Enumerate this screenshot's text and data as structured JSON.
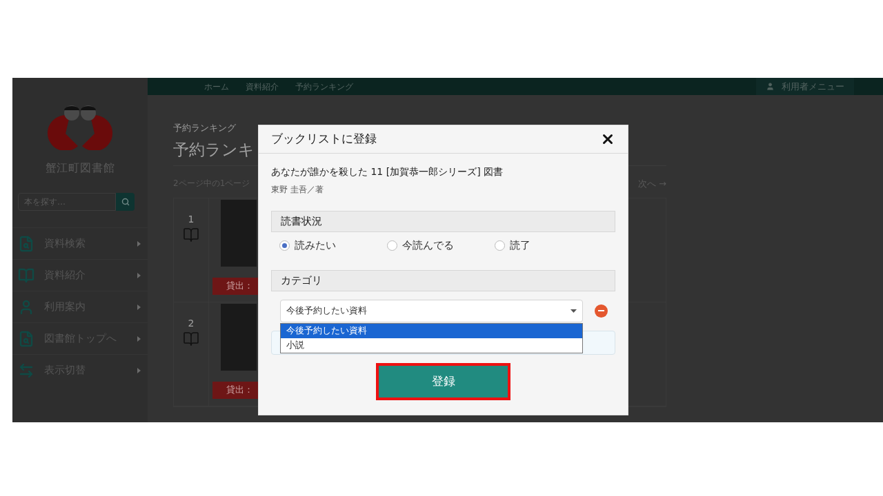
{
  "top_nav": {
    "breadcrumbs": [
      "ホーム",
      "資料紹介",
      "予約ランキング"
    ],
    "user_menu": "利用者メニュー"
  },
  "sidebar": {
    "library_name": "蟹江町図書館",
    "search": {
      "placeholder": "本を探す…"
    },
    "items": [
      {
        "kind": "search",
        "label": "資料検索"
      },
      {
        "kind": "book",
        "label": "資料紹介"
      },
      {
        "kind": "person",
        "label": "利用案内"
      },
      {
        "kind": "search",
        "label": "図書館トップへ"
      },
      {
        "kind": "switch",
        "label": "表示切替"
      }
    ]
  },
  "main": {
    "breadcrumb": "予約ランキング",
    "heading": "予約ランキ",
    "page_info": "2ページ中の1ページ",
    "next": "次へ →",
    "rows": [
      {
        "rank": "1",
        "status": "貸出："
      },
      {
        "rank": "2",
        "status": "貸出："
      }
    ]
  },
  "dialog": {
    "title": "ブックリストに登録",
    "book_title": "あなたが誰かを殺した 11 [加賀恭一郎シリーズ] 図書",
    "author": "東野 圭吾／著",
    "reading_status": {
      "label": "読書状況",
      "options": [
        {
          "label": "読みたい",
          "selected": true
        },
        {
          "label": "今読んでる",
          "selected": false
        },
        {
          "label": "読了",
          "selected": false
        }
      ]
    },
    "category": {
      "label": "カテゴリ",
      "value": "今後予約したい資料",
      "expanded": true,
      "options": [
        {
          "label": "今後予約したい資料",
          "selected": true
        },
        {
          "label": "小説",
          "selected": false
        }
      ]
    },
    "submit": {
      "label": "登録",
      "highlighted": true
    }
  }
}
